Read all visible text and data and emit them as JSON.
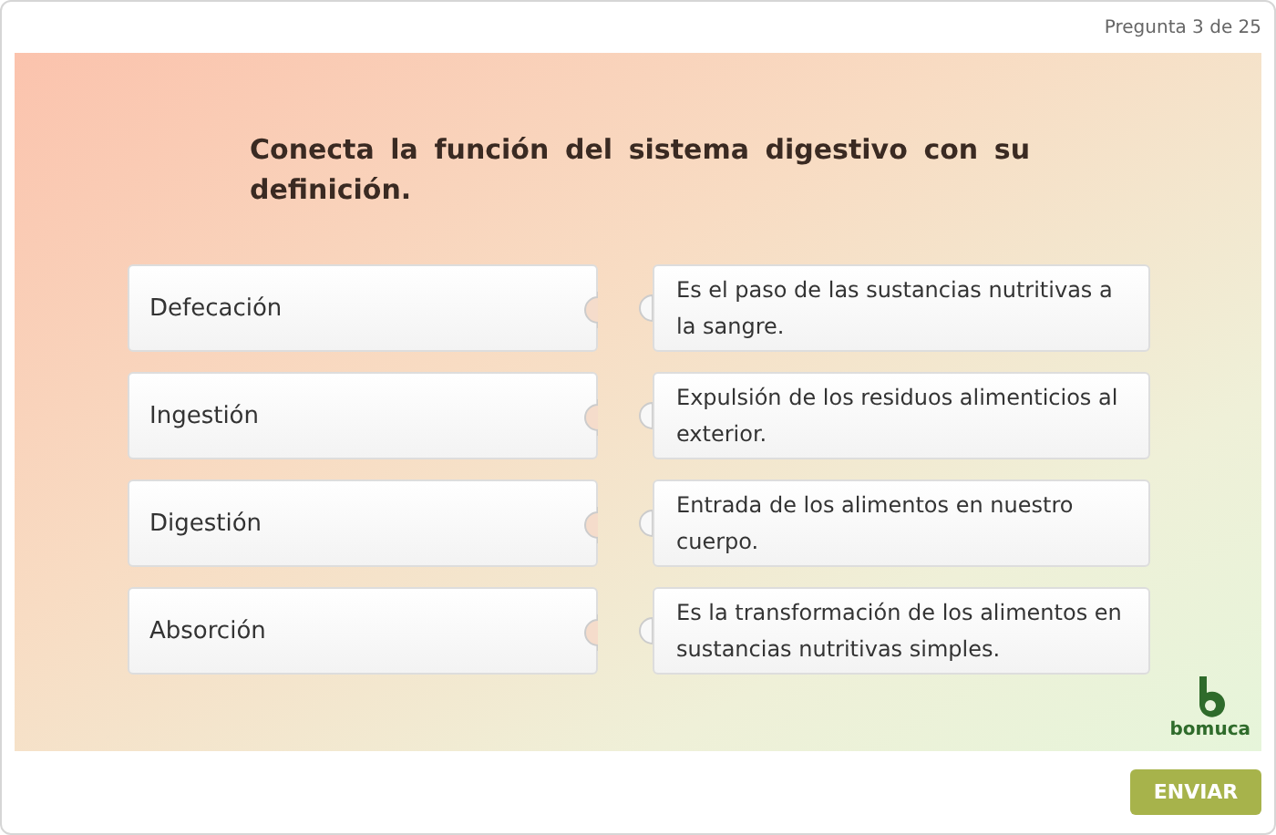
{
  "header": {
    "progress": "Pregunta 3 de 25"
  },
  "question": "Conecta la función del sistema digestivo con su definición.",
  "terms": [
    "Defecación",
    "Ingestión",
    "Digestión",
    "Absorción"
  ],
  "definitions": [
    "Es el paso de las sustancias nutritivas a la sangre.",
    "Expulsión de los residuos alimenticios al exterior.",
    "Entrada de los alimentos en nuestro cuerpo.",
    "Es la transformación de los alimentos en sustancias nutritivas simples."
  ],
  "logo": {
    "name": "bomuca"
  },
  "buttons": [
    {
      "label": "ENVIAR"
    }
  ]
}
